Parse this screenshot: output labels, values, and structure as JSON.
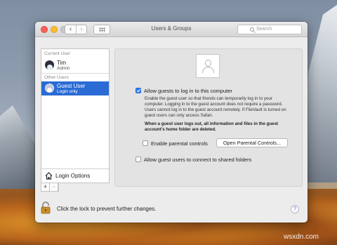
{
  "window": {
    "title": "Users & Groups",
    "search_placeholder": "Search",
    "nav": {
      "back": "‹",
      "forward": "›"
    }
  },
  "sidebar": {
    "current_user_header": "Current User",
    "current_user": {
      "name": "Tim",
      "role": "Admin"
    },
    "other_users_header": "Other Users",
    "other_users": [
      {
        "name": "Guest User",
        "role": "Login only",
        "selected": true
      }
    ],
    "login_options_label": "Login Options",
    "add_button": "+",
    "remove_button": "−"
  },
  "main": {
    "allow_guest_login": {
      "label": "Allow guests to log in to this computer",
      "checked": true
    },
    "description": "Enable the guest user so that friends can temporarily log in to your computer. Logging in to the guest account does not require a password. Users cannot log in to the guest account remotely. If FileVault is turned on guest users can only access Safari.",
    "warning": "When a guest user logs out, all information and files in the guest account's home folder are deleted.",
    "parental_controls": {
      "label": "Enable parental controls",
      "checked": false
    },
    "open_parental_button": "Open Parental Controls...",
    "shared_folders": {
      "label": "Allow guest users to connect to shared folders",
      "checked": false
    }
  },
  "footer": {
    "lock_label": "Click the lock to prevent further changes.",
    "help_button": "?"
  },
  "watermark": "wsxdn.com",
  "colors": {
    "selection": "#2a6bd5",
    "checkbox_checked": "#2f7cf6"
  }
}
